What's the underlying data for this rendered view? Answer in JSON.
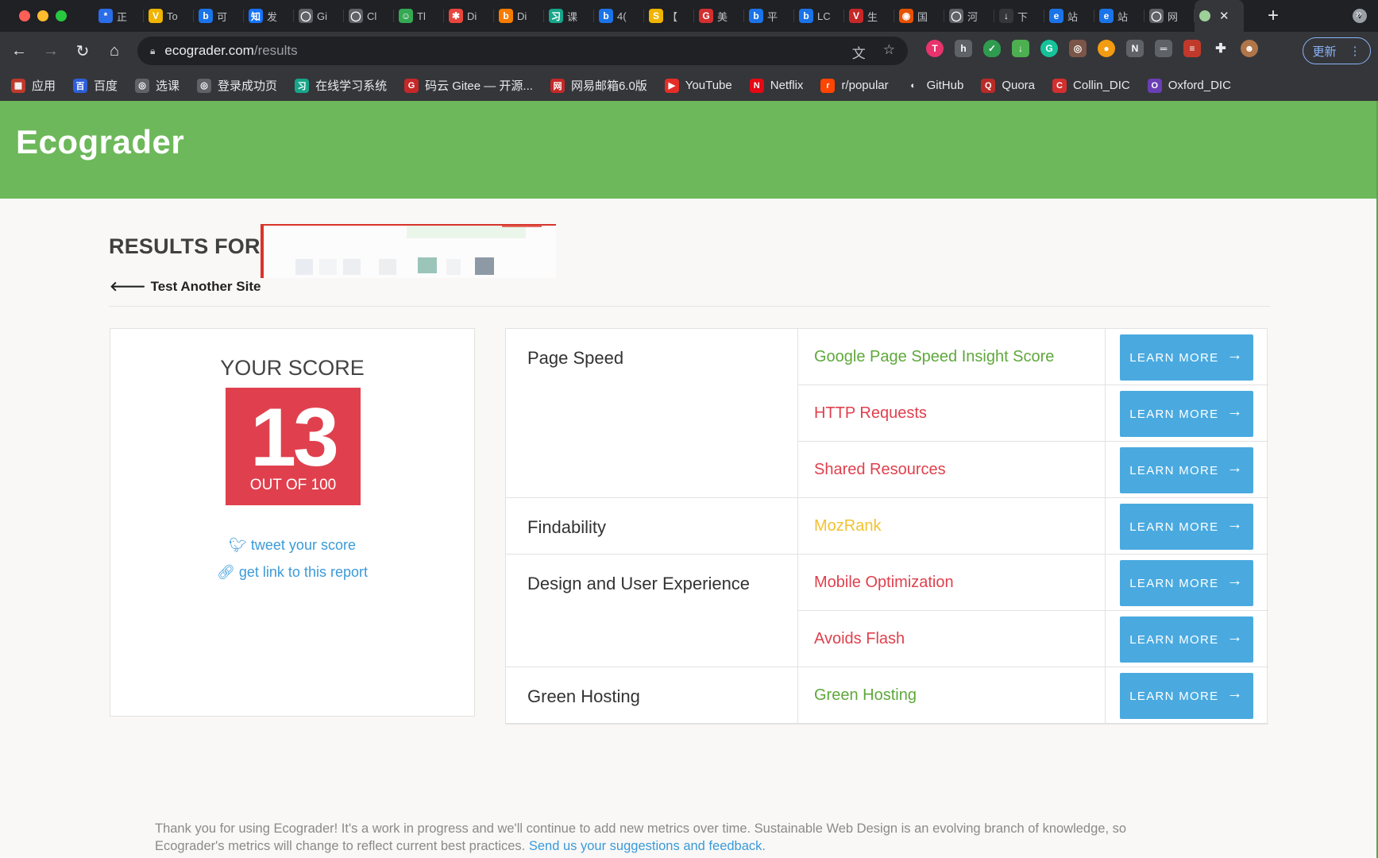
{
  "tabs": [
    {
      "icon": "*",
      "color": "#2b6de8",
      "label": "正"
    },
    {
      "icon": "V",
      "color": "#f0b400",
      "label": "To"
    },
    {
      "icon": "b",
      "color": "#1a73e8",
      "label": "可"
    },
    {
      "icon": "知",
      "color": "#1772f6",
      "label": "发"
    },
    {
      "icon": "◯",
      "color": "#5f6368",
      "label": "Gi"
    },
    {
      "icon": "◯",
      "color": "#5f6368",
      "label": "Cl"
    },
    {
      "icon": "☺",
      "color": "#34a853",
      "label": "Tl"
    },
    {
      "icon": "✱",
      "color": "#e8453c",
      "label": "Di"
    },
    {
      "icon": "b",
      "color": "#f57c00",
      "label": "Di"
    },
    {
      "icon": "习",
      "color": "#17a589",
      "label": "课"
    },
    {
      "icon": "b",
      "color": "#1a73e8",
      "label": "4("
    },
    {
      "icon": "S",
      "color": "#f0b400",
      "label": "【"
    },
    {
      "icon": "G",
      "color": "#d32f2f",
      "label": "美"
    },
    {
      "icon": "b",
      "color": "#1a73e8",
      "label": "平"
    },
    {
      "icon": "b",
      "color": "#1a73e8",
      "label": "LC"
    },
    {
      "icon": "V",
      "color": "#c62828",
      "label": "生"
    },
    {
      "icon": "◉",
      "color": "#e65100",
      "label": "国"
    },
    {
      "icon": "◯",
      "color": "#5f6368",
      "label": "河"
    },
    {
      "icon": "↓",
      "color": "#35363a",
      "label": "下"
    },
    {
      "icon": "e",
      "color": "#1a73e8",
      "label": "站"
    },
    {
      "icon": "e",
      "color": "#1a73e8",
      "label": "站"
    },
    {
      "icon": "◯",
      "color": "#5f6368",
      "label": "网"
    }
  ],
  "toolbar": {
    "url_host": "ecograder.com",
    "url_path": "/results",
    "update_label": "更新"
  },
  "bookmarks": [
    {
      "icon": "▦",
      "color": "#c0392b",
      "label": "应用"
    },
    {
      "icon": "百",
      "color": "#2e5fd8",
      "label": "百度"
    },
    {
      "icon": "◎",
      "color": "#5f6368",
      "label": "选课"
    },
    {
      "icon": "◎",
      "color": "#5f6368",
      "label": "登录成功页"
    },
    {
      "icon": "习",
      "color": "#17a589",
      "label": "在线学习系统"
    },
    {
      "icon": "G",
      "color": "#c62828",
      "label": "码云 Gitee — 开源..."
    },
    {
      "icon": "网",
      "color": "#c62828",
      "label": "网易邮箱6.0版"
    },
    {
      "icon": "▶",
      "color": "#e52d27",
      "label": "YouTube"
    },
    {
      "icon": "N",
      "color": "#e50914",
      "label": "Netflix"
    },
    {
      "icon": "r",
      "color": "#ff4500",
      "label": "r/popular"
    },
    {
      "icon": "◐",
      "color": "#35363a",
      "label": "GitHub"
    },
    {
      "icon": "Q",
      "color": "#b92b27",
      "label": "Quora"
    },
    {
      "icon": "C",
      "color": "#d32f2f",
      "label": "Collin_DIC"
    },
    {
      "icon": "O",
      "color": "#6a3fb5",
      "label": "Oxford_DIC"
    }
  ],
  "page": {
    "logo": "Ecograder",
    "results_for": "RESULTS FOR",
    "back_link": "Test Another Site",
    "score_heading": "YOUR SCORE",
    "score": "13",
    "score_suffix": "OUT OF 100",
    "tweet_label": "tweet your score",
    "link_label": "get link to this report",
    "learn_more": "LEARN MORE",
    "footer_text": "Thank you for using Ecograder! It's a work in progress and we'll continue to add new metrics over time. Sustainable Web Design is an evolving branch of knowledge, so Ecograder's metrics will change to reflect current best practices.",
    "footer_link": "Send us your suggestions and feedback."
  },
  "colors": {
    "green": "#5fa83c",
    "red": "#e0404d",
    "yellow": "#f1c232",
    "blue": "#4aaae0"
  },
  "categories": [
    {
      "name": "Page Speed",
      "metrics": [
        {
          "name": "Google Page Speed Insight Score",
          "status": "green"
        },
        {
          "name": "HTTP Requests",
          "status": "red"
        },
        {
          "name": "Shared Resources",
          "status": "red"
        }
      ]
    },
    {
      "name": "Findability",
      "metrics": [
        {
          "name": "MozRank",
          "status": "yellow"
        }
      ]
    },
    {
      "name": "Design and User Experience",
      "metrics": [
        {
          "name": "Mobile Optimization",
          "status": "red"
        },
        {
          "name": "Avoids Flash",
          "status": "red"
        }
      ]
    },
    {
      "name": "Green Hosting",
      "metrics": [
        {
          "name": "Green Hosting",
          "status": "green"
        }
      ]
    }
  ]
}
